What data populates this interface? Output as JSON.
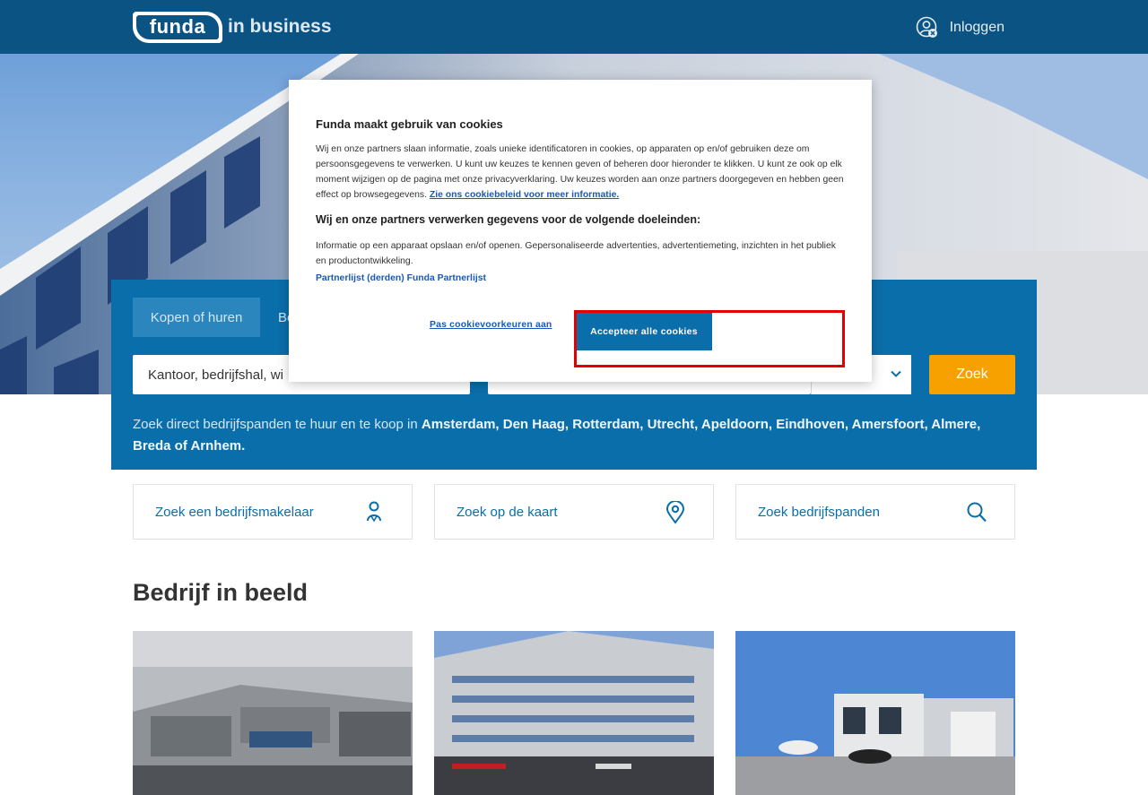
{
  "header": {
    "logo_main": "funda",
    "logo_suffix": "in business",
    "login_label": "Inloggen"
  },
  "search": {
    "tabs": [
      {
        "label": "Kopen of huren",
        "active": true
      },
      {
        "label": "Be",
        "active": false
      }
    ],
    "what_value": "Kantoor, bedrijfshal, wi",
    "where_value": "",
    "range_value": "",
    "search_button": "Zoek",
    "direct_intro": "Zoek direct bedrijfspanden te huur en te koop in ",
    "direct_cities": "Amsterdam, Den Haag, Rotterdam, Utrecht, Apeldoorn, Eindhoven, Amersfoort, Almere, Breda of Arnhem."
  },
  "quick_links": [
    {
      "label": "Zoek een bedrijfsmakelaar",
      "icon": "person-pin-icon"
    },
    {
      "label": "Zoek op de kaart",
      "icon": "map-pin-icon"
    },
    {
      "label": "Zoek bedrijfspanden",
      "icon": "search-icon"
    }
  ],
  "section": {
    "title": "Bedrijf in beeld"
  },
  "cookie_modal": {
    "title": "Funda maakt gebruik van cookies",
    "body": "Wij en onze partners slaan informatie, zoals unieke identificatoren in cookies, op apparaten op en/of gebruiken deze om persoonsgegevens te verwerken. U kunt uw keuzes te kennen geven of beheren door hieronder te klikken. U kunt ze ook op elk moment wijzigen op de pagina met onze privacyverklaring. Uw keuzes worden aan onze partners doorgegeven en hebben geen effect op browsegegevens.",
    "policy_link": "Zie ons cookiebeleid voor meer informatie.",
    "subtitle": "Wij en onze partners verwerken gegevens voor de volgende doeleinden:",
    "purposes": "Informatie op een apparaat opslaan en/of openen. Gepersonaliseerde advertenties, advertentiemeting, inzichten in het publiek en productontwikkeling.",
    "partners_link": "Partnerlijst (derden) Funda Partnerlijst",
    "prefs_button": "Pas cookievoorkeuren aan",
    "accept_button": "Accepteer alle cookies"
  },
  "colors": {
    "header_bg": "#0a5382",
    "panel_bg": "#0a6eaa",
    "search_button": "#f7a100",
    "link": "#1a59b5",
    "highlight": "#e00000"
  }
}
